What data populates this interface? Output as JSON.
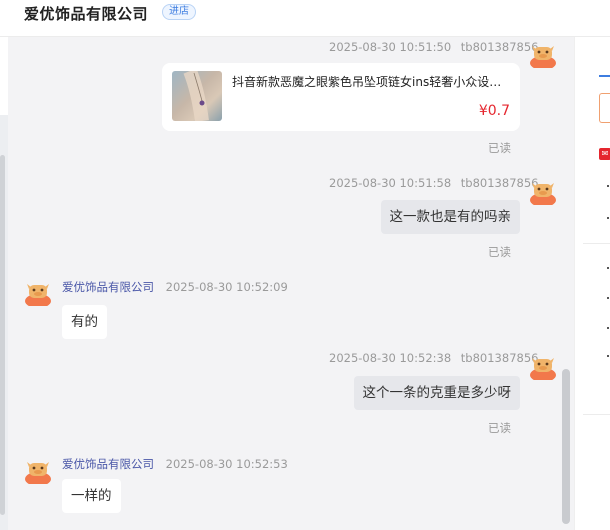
{
  "header": {
    "shop_name": "爱优饰品有限公司",
    "enter_shop_label": "进店"
  },
  "messages": [
    {
      "side": "right",
      "time": "2025-08-30 10:51:50",
      "sender": "tb801387856",
      "type": "product",
      "product": {
        "title": "抖音新款恶魔之眼紫色吊坠项链女ins轻奢小众设计感锁骨链",
        "price": "¥0.7"
      },
      "read": "已读"
    },
    {
      "side": "right",
      "time": "2025-08-30 10:51:58",
      "sender": "tb801387856",
      "text": "这一款也是有的吗亲",
      "read": "已读"
    },
    {
      "side": "left",
      "time": "2025-08-30 10:52:09",
      "sender": "爱优饰品有限公司",
      "text": "有的"
    },
    {
      "side": "right",
      "time": "2025-08-30 10:52:38",
      "sender": "tb801387856",
      "text": "这个一条的克重是多少呀",
      "read": "已读"
    },
    {
      "side": "left",
      "time": "2025-08-30 10:52:53",
      "sender": "爱优饰品有限公司",
      "text": "一样的"
    }
  ],
  "icons": {
    "avatar": "cartoon-bull-avatar-icon",
    "collapse": "double-chevron-right-icon",
    "coupon": "red-gift-icon"
  },
  "colors": {
    "link_blue": "#3d7de0",
    "price_red": "#e5262e",
    "sender_name": "#4a57a8",
    "avatar_orange": "#f2784b"
  }
}
